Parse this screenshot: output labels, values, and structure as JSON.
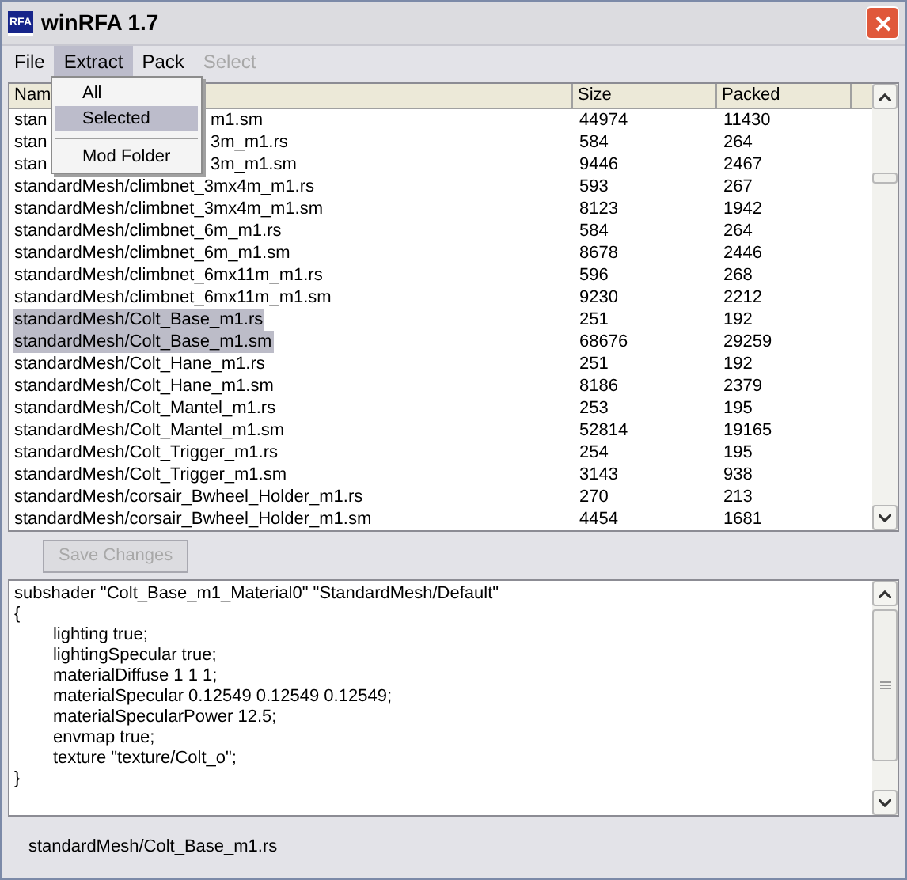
{
  "window": {
    "title": "winRFA 1.7",
    "icon_text": "RFA"
  },
  "menu": [
    {
      "label": "File",
      "selected": false,
      "disabled": false
    },
    {
      "label": "Extract",
      "selected": true,
      "disabled": false
    },
    {
      "label": "Pack",
      "selected": false,
      "disabled": false
    },
    {
      "label": "Select",
      "selected": false,
      "disabled": true
    }
  ],
  "dropdown": [
    {
      "kind": "item",
      "label": "All",
      "selected": false
    },
    {
      "kind": "item",
      "label": "Selected",
      "selected": true
    },
    {
      "kind": "separator"
    },
    {
      "kind": "item",
      "label": "Mod Folder",
      "selected": false
    }
  ],
  "table": {
    "columns": [
      "Nam",
      "Size",
      "Packed"
    ],
    "rows": [
      {
        "name": "stan",
        "name_tail": "m1.sm",
        "size": "44974",
        "packed": "11430",
        "selected": false
      },
      {
        "name": "stan",
        "name_tail": "3m_m1.rs",
        "size": "584",
        "packed": "264",
        "selected": false
      },
      {
        "name": "stan",
        "name_tail": "3m_m1.sm",
        "size": "9446",
        "packed": "2467",
        "selected": false
      },
      {
        "name": "standardMesh/climbnet_3mx4m_m1.rs",
        "size": "593",
        "packed": "267",
        "selected": false
      },
      {
        "name": "standardMesh/climbnet_3mx4m_m1.sm",
        "size": "8123",
        "packed": "1942",
        "selected": false
      },
      {
        "name": "standardMesh/climbnet_6m_m1.rs",
        "size": "584",
        "packed": "264",
        "selected": false
      },
      {
        "name": "standardMesh/climbnet_6m_m1.sm",
        "size": "8678",
        "packed": "2446",
        "selected": false
      },
      {
        "name": "standardMesh/climbnet_6mx11m_m1.rs",
        "size": "596",
        "packed": "268",
        "selected": false
      },
      {
        "name": "standardMesh/climbnet_6mx11m_m1.sm",
        "size": "9230",
        "packed": "2212",
        "selected": false
      },
      {
        "name": "standardMesh/Colt_Base_m1.rs",
        "size": "251",
        "packed": "192",
        "selected": true
      },
      {
        "name": "standardMesh/Colt_Base_m1.sm",
        "size": "68676",
        "packed": "29259",
        "selected": true
      },
      {
        "name": "standardMesh/Colt_Hane_m1.rs",
        "size": "251",
        "packed": "192",
        "selected": false
      },
      {
        "name": "standardMesh/Colt_Hane_m1.sm",
        "size": "8186",
        "packed": "2379",
        "selected": false
      },
      {
        "name": "standardMesh/Colt_Mantel_m1.rs",
        "size": "253",
        "packed": "195",
        "selected": false
      },
      {
        "name": "standardMesh/Colt_Mantel_m1.sm",
        "size": "52814",
        "packed": "19165",
        "selected": false
      },
      {
        "name": "standardMesh/Colt_Trigger_m1.rs",
        "size": "254",
        "packed": "195",
        "selected": false
      },
      {
        "name": "standardMesh/Colt_Trigger_m1.sm",
        "size": "3143",
        "packed": "938",
        "selected": false
      },
      {
        "name": "standardMesh/corsair_Bwheel_Holder_m1.rs",
        "size": "270",
        "packed": "213",
        "selected": false
      },
      {
        "name": "standardMesh/corsair_Bwheel_Holder_m1.sm",
        "size": "4454",
        "packed": "1681",
        "selected": false
      }
    ]
  },
  "save_button": {
    "label": "Save Changes",
    "disabled": true
  },
  "editor": {
    "lines": [
      {
        "text": "subshader \"Colt_Base_m1_Material0\" \"StandardMesh/Default\""
      },
      {
        "text": "{"
      },
      {
        "text": "\t\tlighting true;"
      },
      {
        "text": "\t\tlightingSpecular true;"
      },
      {
        "text": "\t\tmaterialDiffuse 1 1 1;"
      },
      {
        "text": "\t\tmaterialSpecular 0.12549 0.12549 0.12549;"
      },
      {
        "text": "\t\tmaterialSpecularPower 12.5;"
      },
      {
        "text": "\t\tenvmap true;"
      },
      {
        "text": "\t\ttexture \"texture/Colt_o\";"
      },
      {
        "text": "}"
      }
    ]
  },
  "status_bar": "standardMesh/Colt_Base_m1.rs"
}
